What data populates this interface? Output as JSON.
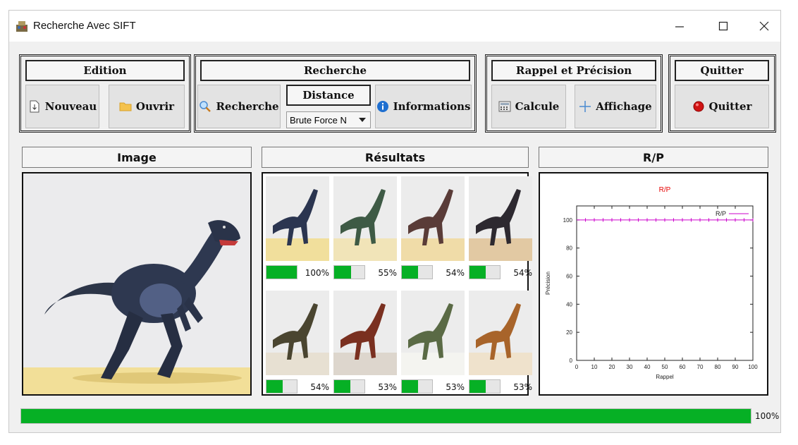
{
  "window": {
    "title": "Recherche Avec SIFT",
    "controls": [
      "—",
      "☐",
      "✕"
    ]
  },
  "toolbar": {
    "edition": {
      "header": "Edition",
      "nouveau": "Nouveau",
      "ouvrir": "Ouvrir"
    },
    "recherche": {
      "header": "Recherche",
      "recherche": "Recherche",
      "distance_label": "Distance",
      "distance_value": "Brute Force N",
      "informations": "Informations"
    },
    "rappel": {
      "header": "Rappel et Précision",
      "calcule": "Calcule",
      "affichage": "Affichage"
    },
    "quitter": {
      "header": "Quitter",
      "quitter": "Quitter"
    }
  },
  "panels": {
    "image": "Image",
    "results": "Résultats",
    "rp": "R/P"
  },
  "results": [
    {
      "score": 1.0,
      "label": "100%",
      "body": "#2b3550",
      "ground": "#f1df9c"
    },
    {
      "score": 0.55,
      "label": "55%",
      "body": "#3e5a45",
      "ground": "#f1e4b8"
    },
    {
      "score": 0.54,
      "label": "54%",
      "body": "#5a3c38",
      "ground": "#f0dca8"
    },
    {
      "score": 0.54,
      "label": "54%",
      "body": "#2d2930",
      "ground": "#e2c9a3"
    },
    {
      "score": 0.54,
      "label": "54%",
      "body": "#4a4530",
      "ground": "#e7e0d2"
    },
    {
      "score": 0.53,
      "label": "53%",
      "body": "#7a3020",
      "ground": "#ddd6cd"
    },
    {
      "score": 0.53,
      "label": "53%",
      "body": "#5a6a45",
      "ground": "#f4f4f0"
    },
    {
      "score": 0.53,
      "label": "53%",
      "body": "#a8642a",
      "ground": "#efe2cc"
    }
  ],
  "chart_data": {
    "type": "line",
    "title": "R/P",
    "xlabel": "Rappel",
    "ylabel": "Précision",
    "xlim": [
      0,
      100
    ],
    "ylim": [
      0,
      110
    ],
    "xticks": [
      0,
      10,
      20,
      30,
      40,
      50,
      60,
      70,
      80,
      90,
      100
    ],
    "yticks": [
      0,
      20,
      40,
      60,
      80,
      100
    ],
    "legend": "top-right",
    "series": [
      {
        "name": "R/P",
        "color": "#cc00cc",
        "x": [
          5,
          10,
          15,
          20,
          25,
          30,
          35,
          40,
          45,
          50,
          55,
          60,
          65,
          70,
          75,
          80,
          85,
          90,
          95,
          100
        ],
        "y": [
          100,
          100,
          100,
          100,
          100,
          100,
          100,
          100,
          100,
          100,
          100,
          100,
          100,
          100,
          100,
          100,
          100,
          100,
          100,
          100
        ]
      }
    ]
  },
  "progress": {
    "value": 1.0,
    "label": "100%"
  },
  "colors": {
    "progress_fill": "#06b025",
    "title_red": "#e60000",
    "series": "#cc00cc"
  }
}
